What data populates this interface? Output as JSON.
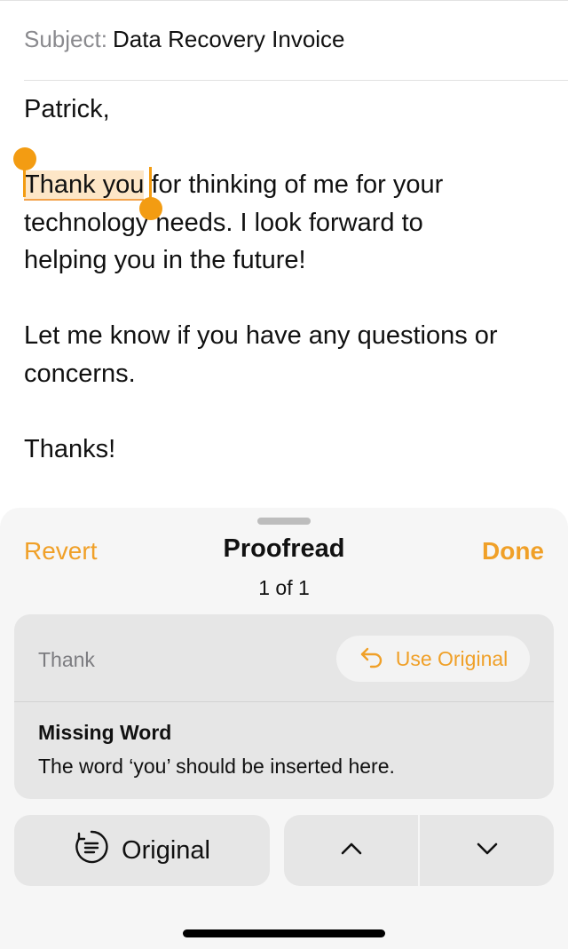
{
  "email": {
    "subject_label": "Subject:",
    "subject_value": "Data Recovery Invoice",
    "greeting": "Patrick,",
    "para1_highlight": "Thank you",
    "para1_rest_a": " for thinking of me for your",
    "para1_line2": "technology needs. I look forward to",
    "para1_line3": "helping you in the future!",
    "para2_line1": "Let me know if you have any questions or",
    "para2_line2": "concerns.",
    "signoff": "Thanks!"
  },
  "proofread": {
    "revert_label": "Revert",
    "title": "Proofread",
    "counter": "1 of 1",
    "done_label": "Done",
    "suggestion_word": "Thank",
    "use_original_label": "Use Original",
    "issue_title": "Missing Word",
    "issue_description": "The word ‘you’ should be inserted here.",
    "original_button_label": "Original",
    "accent_color": "#f0a028",
    "highlight_color": "#fde6c7",
    "icons": {
      "use_original": "undo-arrow-icon",
      "original": "list-circle-icon",
      "previous": "chevron-up-icon",
      "next": "chevron-down-icon"
    }
  }
}
